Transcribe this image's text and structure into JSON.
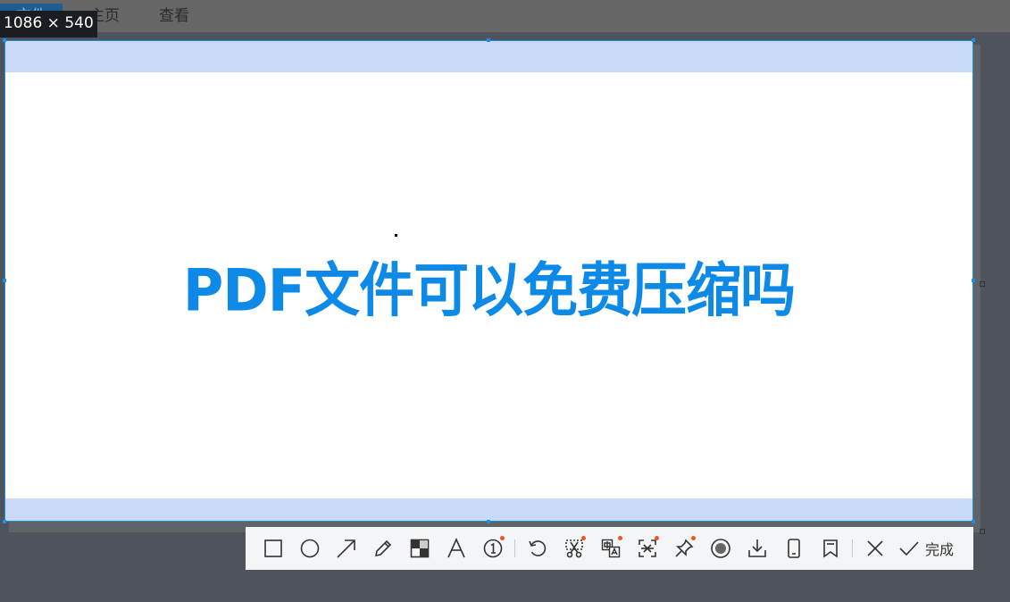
{
  "background_app": {
    "tabs": [
      {
        "label": "文件"
      },
      {
        "label": "主页"
      },
      {
        "label": "查看"
      }
    ]
  },
  "capture": {
    "dimensions_label": "1086 × 540",
    "headline": "PDF文件可以免费压缩吗",
    "headline_color": "#0d8ae8",
    "band_color": "#c9dbf8",
    "border_color": "#1a8fe3"
  },
  "toolbar": {
    "tools": [
      {
        "name": "rectangle-tool",
        "icon": "rectangle-icon",
        "has_badge": false
      },
      {
        "name": "ellipse-tool",
        "icon": "circle-icon",
        "has_badge": false
      },
      {
        "name": "arrow-tool",
        "icon": "arrow-icon",
        "has_badge": false
      },
      {
        "name": "pencil-tool",
        "icon": "pencil-icon",
        "has_badge": false
      },
      {
        "name": "mosaic-tool",
        "icon": "mosaic-icon",
        "has_badge": false
      },
      {
        "name": "text-tool",
        "icon": "text-icon",
        "has_badge": false
      },
      {
        "name": "number-tool",
        "icon": "number-icon",
        "has_badge": true
      },
      {
        "name": "undo-tool",
        "icon": "undo-icon",
        "has_badge": false
      },
      {
        "name": "cutout-tool",
        "icon": "scissors-icon",
        "has_badge": true
      },
      {
        "name": "translate-tool",
        "icon": "translate-icon",
        "has_badge": true
      },
      {
        "name": "ocr-tool",
        "icon": "ocr-icon",
        "has_badge": true
      },
      {
        "name": "pin-tool",
        "icon": "pin-icon",
        "has_badge": true
      },
      {
        "name": "record-tool",
        "icon": "record-icon",
        "has_badge": false
      },
      {
        "name": "download-tool",
        "icon": "download-icon",
        "has_badge": false
      },
      {
        "name": "phone-tool",
        "icon": "phone-icon",
        "has_badge": false
      },
      {
        "name": "bookmark-tool",
        "icon": "bookmark-icon",
        "has_badge": false
      }
    ],
    "close_icon": "close-icon",
    "done_icon": "check-icon",
    "done_label": "完成",
    "badge_color": "#f0532b"
  }
}
